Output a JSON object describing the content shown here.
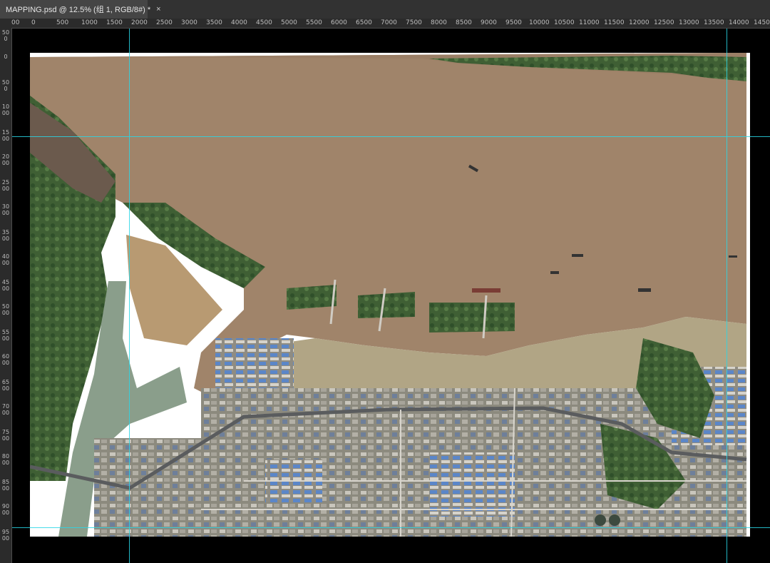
{
  "tab": {
    "title": "MAPPING.psd @ 12.5% (组 1, RGB/8#) *",
    "close": "×"
  },
  "ruler": {
    "horizontal_labels": [
      "00",
      "0",
      "500",
      "1000",
      "1500",
      "2000",
      "2500",
      "3000",
      "3500",
      "4000",
      "4500",
      "5000",
      "5500",
      "6000",
      "6500",
      "7000",
      "7500",
      "8000",
      "8500",
      "9000",
      "9500",
      "10000",
      "10500",
      "11000",
      "11500",
      "12000",
      "12500",
      "13000",
      "13500",
      "14000",
      "14500"
    ],
    "vertical_labels": [
      "500",
      "0",
      "500",
      "1000",
      "1500",
      "2000",
      "2500",
      "3000",
      "3500",
      "4000",
      "4500",
      "5000",
      "5500",
      "6000",
      "6500",
      "7000",
      "7500",
      "8000",
      "8500",
      "9000",
      "9500"
    ]
  },
  "colors": {
    "guide": "#29d6e6",
    "river": "#a0846a",
    "canvas_bg": "#000000"
  }
}
